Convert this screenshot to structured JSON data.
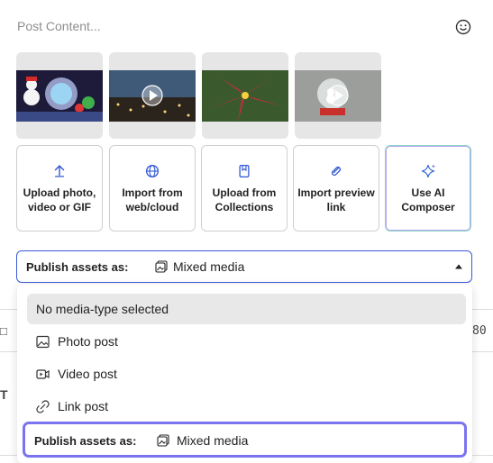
{
  "composer": {
    "placeholder": "Post Content..."
  },
  "media": [
    {
      "kind": "photo",
      "name": "snowman-photo"
    },
    {
      "kind": "video",
      "name": "city-video"
    },
    {
      "kind": "photo",
      "name": "poinsettia-photo"
    },
    {
      "kind": "video",
      "name": "snowglobe-video"
    }
  ],
  "actions": [
    {
      "label": "Upload photo, video or GIF",
      "icon": "upload-icon"
    },
    {
      "label": "Import from web/cloud",
      "icon": "globe-icon"
    },
    {
      "label": "Upload from Collections",
      "icon": "bookmark-icon"
    },
    {
      "label": "Import preview link",
      "icon": "link-icon"
    },
    {
      "label": "Use AI Composer",
      "icon": "sparkle-icon"
    }
  ],
  "publish": {
    "label": "Publish assets as:",
    "value": "Mixed media"
  },
  "dropdown": {
    "options": [
      {
        "label": "No media-type selected"
      },
      {
        "label": "Photo post",
        "icon": "photo-icon"
      },
      {
        "label": "Video post",
        "icon": "video-icon"
      },
      {
        "label": "Link post",
        "icon": "link-icon"
      }
    ]
  },
  "background": {
    "right_text": "80"
  },
  "colors": {
    "focus": "#3a5bd9",
    "highlight": "#7b74ef",
    "ai_border": "#8ad3c8"
  }
}
